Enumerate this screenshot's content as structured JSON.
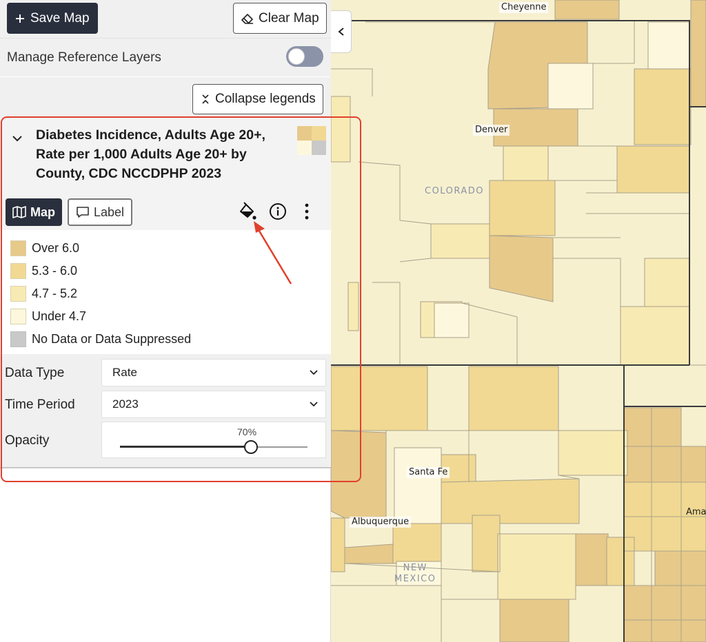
{
  "toolbar": {
    "save_label": "Save Map",
    "clear_label": "Clear Map"
  },
  "reference_layers": {
    "label": "Manage Reference Layers",
    "enabled": false
  },
  "legend_controls": {
    "collapse_label": "Collapse legends"
  },
  "layer": {
    "title": "Diabetes Incidence, Adults Age 20+, Rate per 1,000 Adults Age 20+ by County, CDC NCCDPHP 2023",
    "tabs": {
      "map": "Map",
      "label": "Label"
    },
    "legend": [
      {
        "label": "Over 6.0",
        "color": "#e7c98a"
      },
      {
        "label": "5.3 - 6.0",
        "color": "#f1d993"
      },
      {
        "label": "4.7 - 5.2",
        "color": "#f8eab3"
      },
      {
        "label": "Under 4.7",
        "color": "#fdf8dd"
      },
      {
        "label": "No Data or Data Suppressed",
        "color": "#c9c9c9"
      }
    ],
    "controls": {
      "data_type_label": "Data Type",
      "data_type_value": "Rate",
      "time_period_label": "Time Period",
      "time_period_value": "2023",
      "opacity_label": "Opacity",
      "opacity_text": "70%",
      "opacity_value": 0.7
    }
  },
  "map": {
    "labels": {
      "cheyenne": "Cheyenne",
      "denver": "Denver",
      "santa_fe": "Santa Fe",
      "albuquerque": "Albuquerque",
      "amarillo": "Amar",
      "colorado": "COLORADO",
      "new_mexico_line1": "NEW",
      "new_mexico_line2": "MEXICO"
    }
  },
  "colors": {
    "accent_dark": "#2a2f3d",
    "annotation": "#e0402c"
  }
}
